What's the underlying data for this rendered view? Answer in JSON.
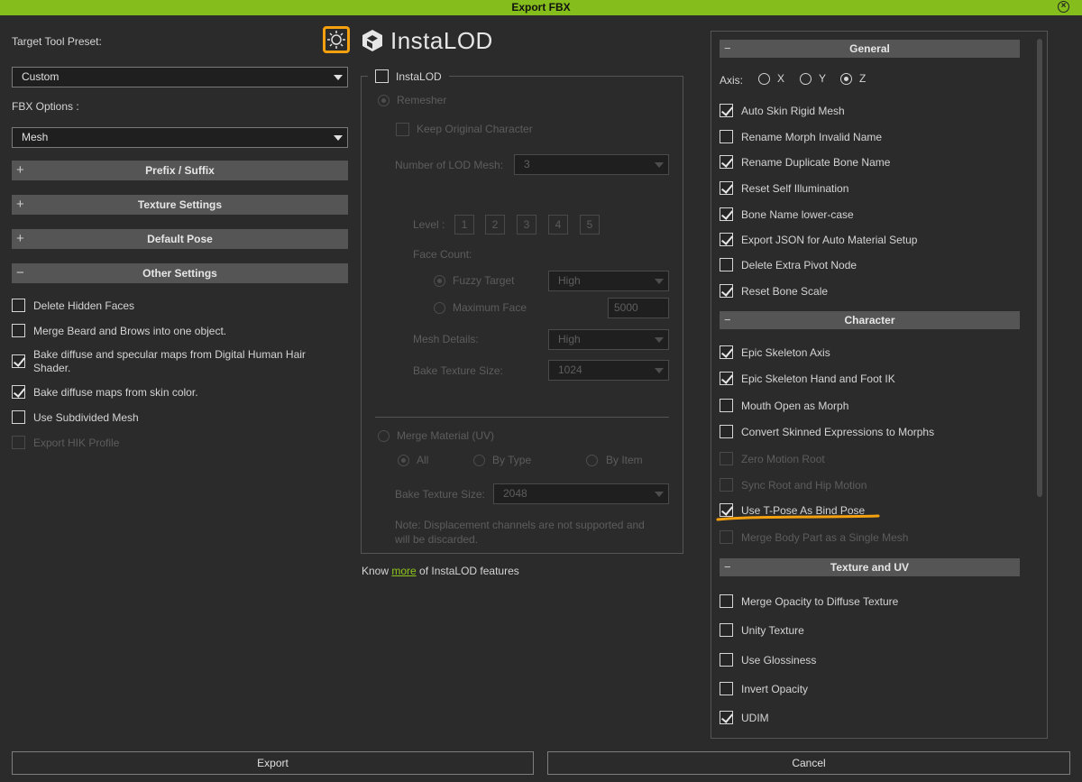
{
  "window": {
    "title": "Export FBX"
  },
  "left": {
    "preset_label": "Target Tool Preset:",
    "preset_value": "Custom",
    "fbx_label": "FBX Options :",
    "fbx_value": "Mesh",
    "sections": [
      {
        "sign": "+",
        "label": "Prefix / Suffix"
      },
      {
        "sign": "+",
        "label": "Texture Settings"
      },
      {
        "sign": "+",
        "label": "Default Pose"
      },
      {
        "sign": "−",
        "label": "Other Settings"
      }
    ],
    "other_settings": [
      {
        "label": "Delete Hidden Faces",
        "checked": false,
        "enabled": true
      },
      {
        "label": "Merge Beard and Brows into one object.",
        "checked": false,
        "enabled": true
      },
      {
        "label": "Bake diffuse and specular maps from Digital Human Hair",
        "label2": "Shader.",
        "checked": true,
        "enabled": true
      },
      {
        "label": "Bake diffuse maps from skin color.",
        "checked": true,
        "enabled": true
      },
      {
        "label": "Use Subdivided Mesh",
        "checked": false,
        "enabled": true
      },
      {
        "label": "Export HIK Profile",
        "checked": false,
        "enabled": false
      }
    ]
  },
  "middle": {
    "logo_text": "InstaLOD",
    "instalod_label": "InstaLOD",
    "remesher": "Remesher",
    "keep_original": "Keep Original Character",
    "lod_count_label": "Number of LOD Mesh:",
    "lod_count_value": "3",
    "level_label": "Level :",
    "levels": [
      "1",
      "2",
      "3",
      "4",
      "5"
    ],
    "face_count_label": "Face Count:",
    "fuzzy_target": "Fuzzy Target",
    "fuzzy_value": "High",
    "max_face": "Maximum Face",
    "max_face_value": "5000",
    "mesh_details_label": "Mesh Details:",
    "mesh_details_value": "High",
    "bake_size_label": "Bake Texture Size:",
    "bake_size_value": "1024",
    "merge_material": "Merge Material (UV)",
    "merge_all": "All",
    "merge_by_type": "By Type",
    "merge_by_item": "By Item",
    "merge_bake_label": "Bake Texture Size:",
    "merge_bake_value": "2048",
    "note_line1": "Note: Displacement channels are not supported and",
    "note_line2": "will be discarded.",
    "know_pre": "Know ",
    "know_link": "more",
    "know_post": " of InstaLOD features"
  },
  "right": {
    "general_title": "General",
    "axis_label": "Axis:",
    "axis_options": [
      "X",
      "Y",
      "Z"
    ],
    "axis_selected": "Z",
    "general_items": [
      {
        "label": "Auto Skin Rigid Mesh",
        "checked": true,
        "enabled": true
      },
      {
        "label": "Rename Morph Invalid Name",
        "checked": false,
        "enabled": true
      },
      {
        "label": "Rename Duplicate Bone Name",
        "checked": true,
        "enabled": true
      },
      {
        "label": "Reset Self Illumination",
        "checked": true,
        "enabled": true
      },
      {
        "label": "Bone Name lower-case",
        "checked": true,
        "enabled": true
      },
      {
        "label": "Export JSON for Auto Material Setup",
        "checked": true,
        "enabled": true
      },
      {
        "label": "Delete Extra Pivot Node",
        "checked": false,
        "enabled": true
      },
      {
        "label": "Reset Bone Scale",
        "checked": true,
        "enabled": true
      }
    ],
    "character_title": "Character",
    "character_items": [
      {
        "label": "Epic Skeleton Axis",
        "checked": true,
        "enabled": true
      },
      {
        "label": "Epic Skeleton Hand and Foot IK",
        "checked": true,
        "enabled": true
      },
      {
        "label": "Mouth Open as Morph",
        "checked": false,
        "enabled": true
      },
      {
        "label": "Convert Skinned Expressions to Morphs",
        "checked": false,
        "enabled": true
      },
      {
        "label": "Zero Motion Root",
        "checked": false,
        "enabled": false
      },
      {
        "label": "Sync Root and Hip Motion",
        "checked": false,
        "enabled": false
      },
      {
        "label": "Use T-Pose As Bind Pose",
        "checked": true,
        "enabled": true
      },
      {
        "label": "Merge Body Part as a Single Mesh",
        "checked": false,
        "enabled": false
      }
    ],
    "texture_title": "Texture and UV",
    "texture_items": [
      {
        "label": "Merge Opacity to Diffuse Texture",
        "checked": false,
        "enabled": true
      },
      {
        "label": "Unity Texture",
        "checked": false,
        "enabled": true
      },
      {
        "label": "Use Glossiness",
        "checked": false,
        "enabled": true
      },
      {
        "label": "Invert Opacity",
        "checked": false,
        "enabled": true
      },
      {
        "label": "UDIM",
        "checked": true,
        "enabled": true
      }
    ]
  },
  "footer": {
    "export_label": "Export",
    "cancel_label": "Cancel"
  },
  "colors": {
    "accent": "#85be1c",
    "highlight": "#f5a10f",
    "link": "#8ec61c"
  }
}
